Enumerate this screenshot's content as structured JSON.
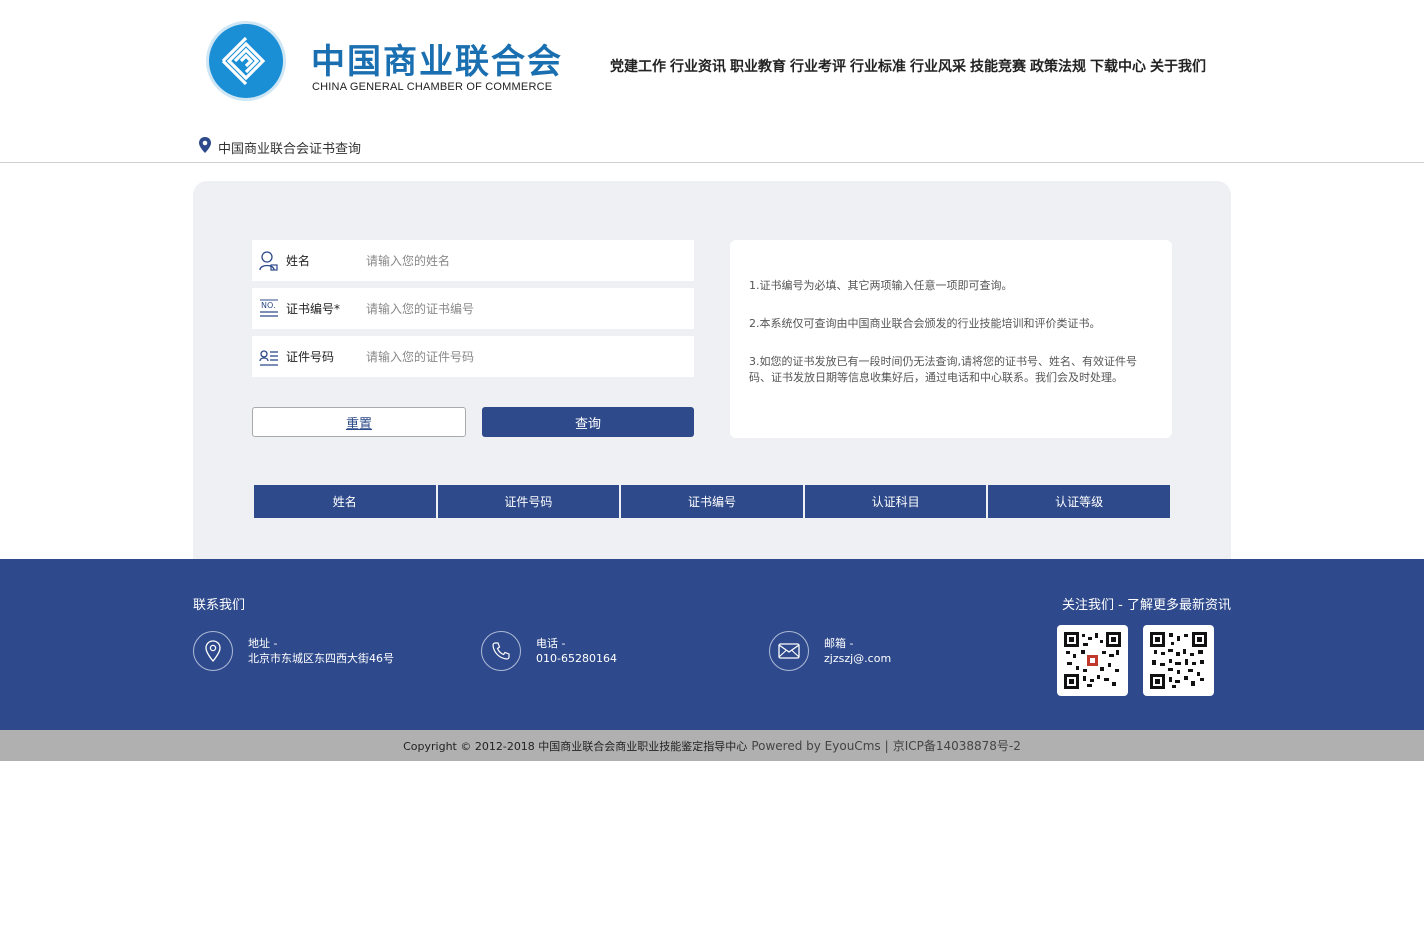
{
  "header": {
    "logo_cn": "中国商业联合会",
    "logo_en": "CHINA GENERAL CHAMBER OF COMMERCE",
    "nav": [
      "党建工作",
      "行业资讯",
      "职业教育",
      "行业考评",
      "行业标准",
      "行业风采",
      "技能竞赛",
      "政策法规",
      "下载中心",
      "关于我们"
    ]
  },
  "breadcrumb": {
    "text": "中国商业联合会证书查询"
  },
  "form": {
    "name_label": "姓名",
    "name_placeholder": "请输入您的姓名",
    "cert_no_label": "证书编号*",
    "cert_no_placeholder": "请输入您的证书编号",
    "id_label": "证件号码",
    "id_placeholder": "请输入您的证件号码",
    "reset_label": "重置",
    "query_label": "查询"
  },
  "notes": [
    "1.证书编号为必填、其它两项输入任意一项即可查询。",
    "2.本系统仅可查询由中国商业联合会颁发的行业技能培训和评价类证书。",
    "3.如您的证书发放已有一段时间仍无法查询,请将您的证书号、姓名、有效证件号码、证书发放日期等信息收集好后，通过电话和中心联系。我们会及时处理。"
  ],
  "table": {
    "headers": [
      "姓名",
      "证件号码",
      "证书编号",
      "认证科目",
      "认证等级"
    ]
  },
  "footer": {
    "contact_title": "联系我们",
    "follow_title": "关注我们 - 了解更多最新资讯",
    "address_label": "地址 -",
    "address_value": "北京市东城区东四西大街46号",
    "phone_label": "电话 -",
    "phone_value": "010-65280164",
    "email_label": "邮箱 -",
    "email_value": "zjzszj@.com"
  },
  "copyright": {
    "text": "Copyright © 2012-2018 中国商业联合会商业职业技能鉴定指导中心",
    "powered": "Powered by EyouCms",
    "sep": "|",
    "icp": "京ICP备14038878号-2"
  },
  "colors": {
    "brand_blue": "#2e4a8b",
    "logo_blue": "#1a8fd6",
    "panel_bg": "#eff0f3"
  }
}
